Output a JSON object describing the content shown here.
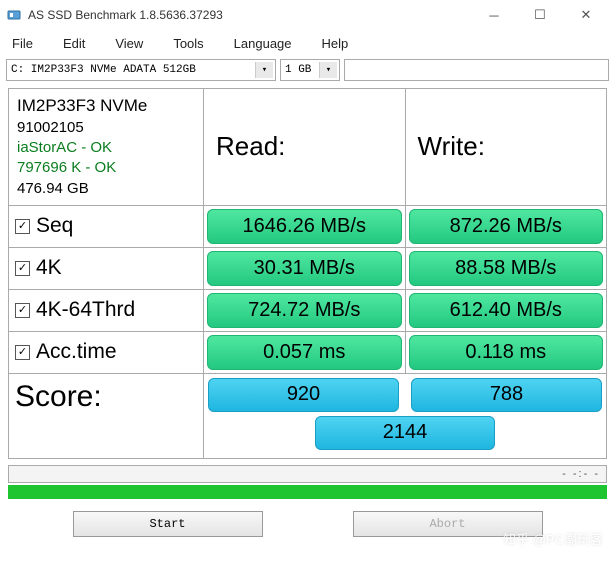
{
  "window": {
    "title": "AS SSD Benchmark 1.8.5636.37293"
  },
  "menu": {
    "file": "File",
    "edit": "Edit",
    "view": "View",
    "tools": "Tools",
    "language": "Language",
    "help": "Help"
  },
  "toolbar": {
    "drive_selected": "C: IM2P33F3 NVMe ADATA 512GB",
    "size_selected": "1 GB"
  },
  "device": {
    "name": "IM2P33F3 NVMe",
    "firmware": "91002105",
    "driver": "iaStorAC - OK",
    "alignment": "797696 K - OK",
    "capacity": "476.94 GB"
  },
  "headers": {
    "read": "Read:",
    "write": "Write:"
  },
  "tests": {
    "seq": {
      "label": "Seq",
      "read": "1646.26 MB/s",
      "write": "872.26 MB/s"
    },
    "fk": {
      "label": "4K",
      "read": "30.31 MB/s",
      "write": "88.58 MB/s"
    },
    "fk64": {
      "label": "4K-64Thrd",
      "read": "724.72 MB/s",
      "write": "612.40 MB/s"
    },
    "acc": {
      "label": "Acc.time",
      "read": "0.057 ms",
      "write": "0.118 ms"
    }
  },
  "score": {
    "label": "Score:",
    "read": "920",
    "write": "788",
    "total": "2144"
  },
  "progress_text": "- -:- -",
  "buttons": {
    "start": "Start",
    "abort": "Abort"
  },
  "watermark": "知乎 @PC潮玩客",
  "checkmark": "☑"
}
